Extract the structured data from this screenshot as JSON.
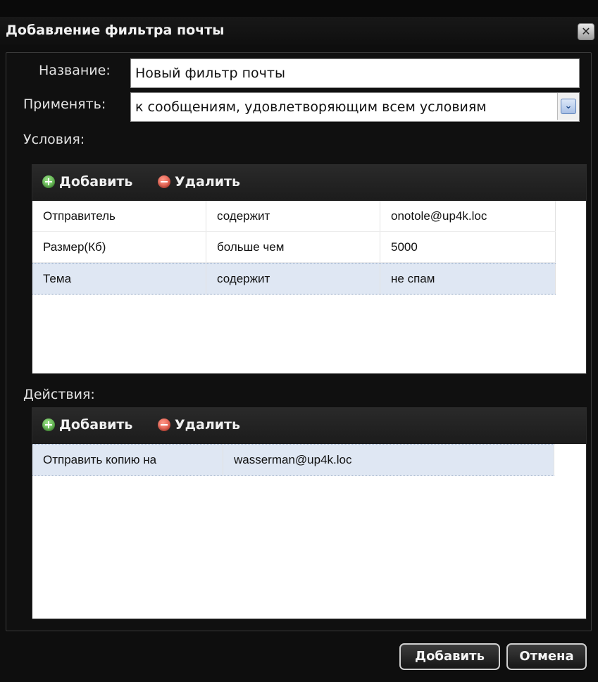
{
  "dialog": {
    "title": "Добавление фильтра почты",
    "close_symbol": "✕",
    "close_icon": "close-icon"
  },
  "form": {
    "name_label": "Название:",
    "name_value": "Новый фильтр почты",
    "apply_label": "Применять:",
    "apply_value": "к сообщениям, удовлетворяющим всем условиям",
    "dropdown_icon": "chevron-down-icon"
  },
  "conditions": {
    "label": "Условия:",
    "add_label": "Добавить",
    "delete_label": "Удалить",
    "rows": [
      {
        "field": "Отправитель",
        "op": "содержит",
        "value": "onotole@up4k.loc"
      },
      {
        "field": "Размер(Кб)",
        "op": "больше чем",
        "value": "5000"
      },
      {
        "field": "Тема",
        "op": "содержит",
        "value": "не спам"
      }
    ],
    "selected_row": 2
  },
  "actions": {
    "label": "Действия:",
    "add_label": "Добавить",
    "delete_label": "Удалить",
    "rows": [
      {
        "action": "Отправить копию на",
        "value": "wasserman@up4k.loc"
      }
    ],
    "selected_row": 0
  },
  "footer": {
    "add_button": "Добавить",
    "cancel_button": "Отмена"
  },
  "colors": {
    "add_icon": "#3f9a2e",
    "delete_icon": "#d23a2a",
    "selected_row": "#dfe7f3"
  }
}
